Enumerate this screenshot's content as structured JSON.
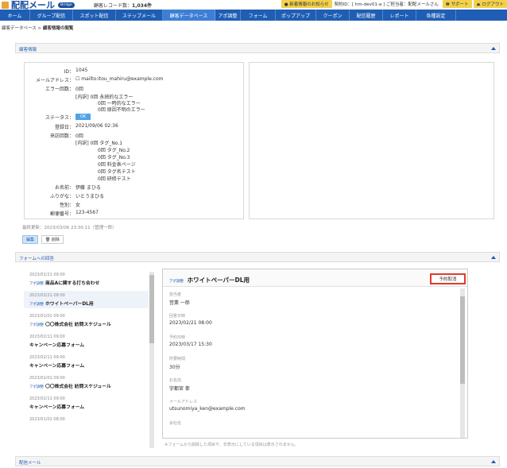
{
  "header": {
    "logo_text": "配配メール",
    "logo_badge": "Bridge",
    "record_label": "顧客レコード数：",
    "record_count": "1,034件",
    "notice": "● 新着情報のお知らせ",
    "contract": "契約ID：[ hm-dev01-a ]  ご担当者：配配メールさん",
    "support": "❷ サポート",
    "logout": "⏏ ログアウト"
  },
  "nav": {
    "items": [
      {
        "label": "ホーム"
      },
      {
        "label": "グループ配信"
      },
      {
        "label": "スポット配信"
      },
      {
        "label": "ステップメール"
      },
      {
        "label": "顧客データベース"
      },
      {
        "label": "アポ調整"
      },
      {
        "label": "フォーム"
      },
      {
        "label": "ポップアップ"
      },
      {
        "label": "クーポン"
      },
      {
        "label": "配信履歴"
      },
      {
        "label": "レポート"
      },
      {
        "label": "各種設定"
      }
    ],
    "active_index": 4
  },
  "breadcrumb": {
    "root": "顧客データベース",
    "sep": ">",
    "current": "顧客情報の閲覧"
  },
  "customer": {
    "section_title": "顧客情報",
    "rows": [
      {
        "label": "ID：",
        "value": "1045"
      },
      {
        "label": "メールアドレス：",
        "value": "☐ mailto:itou_mahiru@example.com"
      },
      {
        "label": "エラー回数：",
        "value": "0回"
      },
      {
        "label": "",
        "value": "[内訳] 0回 永続的なエラー"
      },
      {
        "label": "",
        "value": "0回 一時的なエラー"
      },
      {
        "label": "",
        "value": "0回 原因不明のエラー"
      },
      {
        "label": "ステータス：",
        "value": "OK"
      },
      {
        "label": "登録日：",
        "value": "2021/09/06 02:36"
      },
      {
        "label": "来訪回数：",
        "value": "0回"
      },
      {
        "label": "",
        "value": "[内訳] 0回 タグ_No.1"
      },
      {
        "label": "",
        "value": "0回 タグ_No.2"
      },
      {
        "label": "",
        "value": "0回 タグ_No.3"
      },
      {
        "label": "",
        "value": "0回 料金表ページ"
      },
      {
        "label": "",
        "value": "0回 タグ名テスト"
      },
      {
        "label": "",
        "value": "0回 研修テスト"
      },
      {
        "label": "お名前：",
        "value": "伊藤 まひる"
      },
      {
        "label": "ふりがな：",
        "value": "いとうまひる"
      },
      {
        "label": "性別：",
        "value": "女"
      },
      {
        "label": "郵便番号：",
        "value": "123-4567"
      }
    ],
    "last_updated": "最終更新：2023/03/06 23:30:11（管理一郎）",
    "edit_label": "編集",
    "delete_label": "🗑 削除"
  },
  "forms": {
    "section_title": "フォームへの回答",
    "items": [
      {
        "date": "2023/02/21 09:00",
        "tag": "アポ調整",
        "title": "商品Aに関する打ち合わせ"
      },
      {
        "date": "2023/02/21 08:00",
        "tag": "アポ調整",
        "title": "ホワイトペーパーDL用"
      },
      {
        "date": "2023/01/01 09:00",
        "tag": "アポ調整",
        "title": "〇〇株式会社 訪問スケジュール"
      },
      {
        "date": "2023/02/11 09:00",
        "tag": "",
        "title": "キャンペーン応募フォーム"
      },
      {
        "date": "2023/02/11 09:00",
        "tag": "",
        "title": "キャンペーン応募フォーム"
      },
      {
        "date": "2023/01/01 09:00",
        "tag": "アポ調整",
        "title": "〇〇株式会社 訪問スケジュール"
      },
      {
        "date": "2023/02/11 09:00",
        "tag": "",
        "title": "キャンペーン応募フォーム"
      },
      {
        "date": "2023/01/01 08:00",
        "tag": "",
        "title": ""
      }
    ],
    "selected_index": 1,
    "detail": {
      "tag": "アポ調整",
      "title": "ホワイトペーパーDL用",
      "cancel_label": "予約取消",
      "fields": [
        {
          "label": "担当者",
          "value": "営業 一郎"
        },
        {
          "label": "回答日時",
          "value": "2023/02/21 08:00"
        },
        {
          "label": "予約日時",
          "value": "2023/03/17 15:30"
        },
        {
          "label": "所要時間",
          "value": "30分"
        },
        {
          "label": "お名前",
          "value": "宇都宮 拳"
        },
        {
          "label": "メールアドレス",
          "value": "utsunomiya_ken@example.com"
        },
        {
          "label": "会社名",
          "value": ""
        }
      ]
    },
    "note": "※フォームから削除した項目や、非表示にしている項目は表示されません。"
  },
  "mail": {
    "section_title": "配信メール"
  },
  "colors": {
    "nav_bg": "#1f5eb4",
    "nav_active": "#3d7fd6",
    "highlight_border": "#e23a2d",
    "status_ok": "#4fa3e6"
  }
}
